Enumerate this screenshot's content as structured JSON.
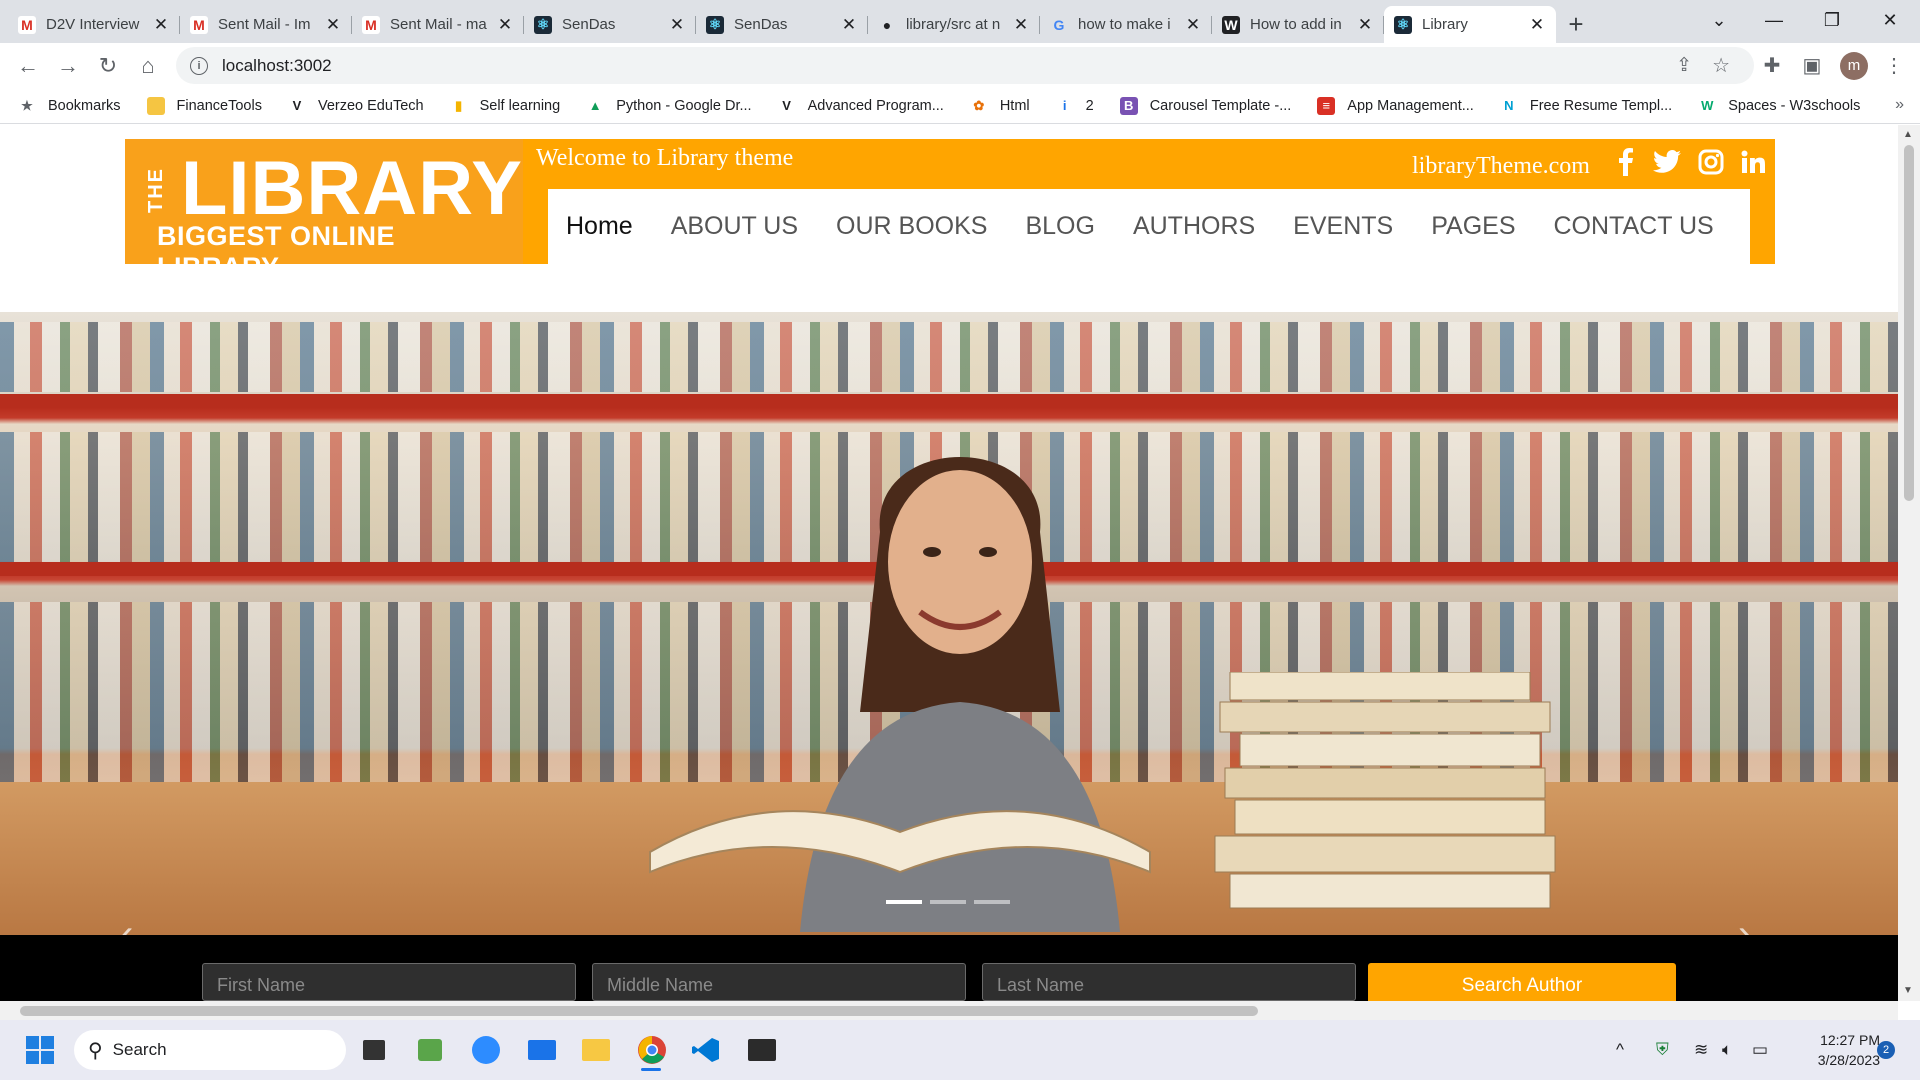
{
  "browser": {
    "tabs": [
      {
        "title": "D2V Interview",
        "icon": "gmail-icon",
        "active": false
      },
      {
        "title": "Sent Mail - Im",
        "icon": "gmail-icon",
        "active": false
      },
      {
        "title": "Sent Mail - ma",
        "icon": "gmail-icon",
        "active": false
      },
      {
        "title": "SenDas",
        "icon": "react-icon",
        "active": false
      },
      {
        "title": "SenDas",
        "icon": "react-icon",
        "active": false
      },
      {
        "title": "library/src at n",
        "icon": "github-icon",
        "active": false
      },
      {
        "title": "how to make i",
        "icon": "google-icon",
        "active": false
      },
      {
        "title": "How to add in",
        "icon": "wikihow-icon",
        "active": false
      },
      {
        "title": "Library",
        "icon": "react-icon",
        "active": true
      }
    ],
    "url": "localhost:3002",
    "profile_initial": "m",
    "bookmarks": [
      {
        "label": "Bookmarks",
        "icon": "star-icon"
      },
      {
        "label": "FinanceTools",
        "icon": "folder-icon"
      },
      {
        "label": "Verzeo EduTech",
        "icon": "verzeo-icon"
      },
      {
        "label": "Self learning",
        "icon": "chart-icon"
      },
      {
        "label": "Python - Google Dr...",
        "icon": "drive-icon"
      },
      {
        "label": "Advanced Program...",
        "icon": "verzeo-icon"
      },
      {
        "label": "Html",
        "icon": "bug-icon"
      },
      {
        "label": "2",
        "icon": "info-icon"
      },
      {
        "label": "Carousel Template -...",
        "icon": "bootstrap-icon"
      },
      {
        "label": "App Management...",
        "icon": "app-icon"
      },
      {
        "label": "Free Resume Templ...",
        "icon": "n-icon"
      },
      {
        "label": "Spaces - W3schools",
        "icon": "w3-icon"
      }
    ]
  },
  "site": {
    "logo_the": "THE",
    "logo_main": "LIBRARY",
    "logo_tag": "BIGGEST ONLINE LIBRARY",
    "welcome": "Welcome to Library theme",
    "domain": "libraryTheme.com",
    "social": [
      "facebook-icon",
      "twitter-icon",
      "instagram-icon",
      "linkedin-icon"
    ],
    "menu": [
      "Home",
      "ABOUT US",
      "OUR BOOKS",
      "BLOG",
      "AUTHORS",
      "EVENTS",
      "PAGES",
      "CONTACT US"
    ],
    "active_menu": "Home",
    "brand_color": "#ffa500"
  },
  "search": {
    "first_name_placeholder": "First Name",
    "middle_name_placeholder": "Middle Name",
    "last_name_placeholder": "Last Name",
    "button_label": "Search Author"
  },
  "taskbar": {
    "search_label": "Search",
    "time": "12:27 PM",
    "date": "3/28/2023",
    "notifications": "2"
  }
}
